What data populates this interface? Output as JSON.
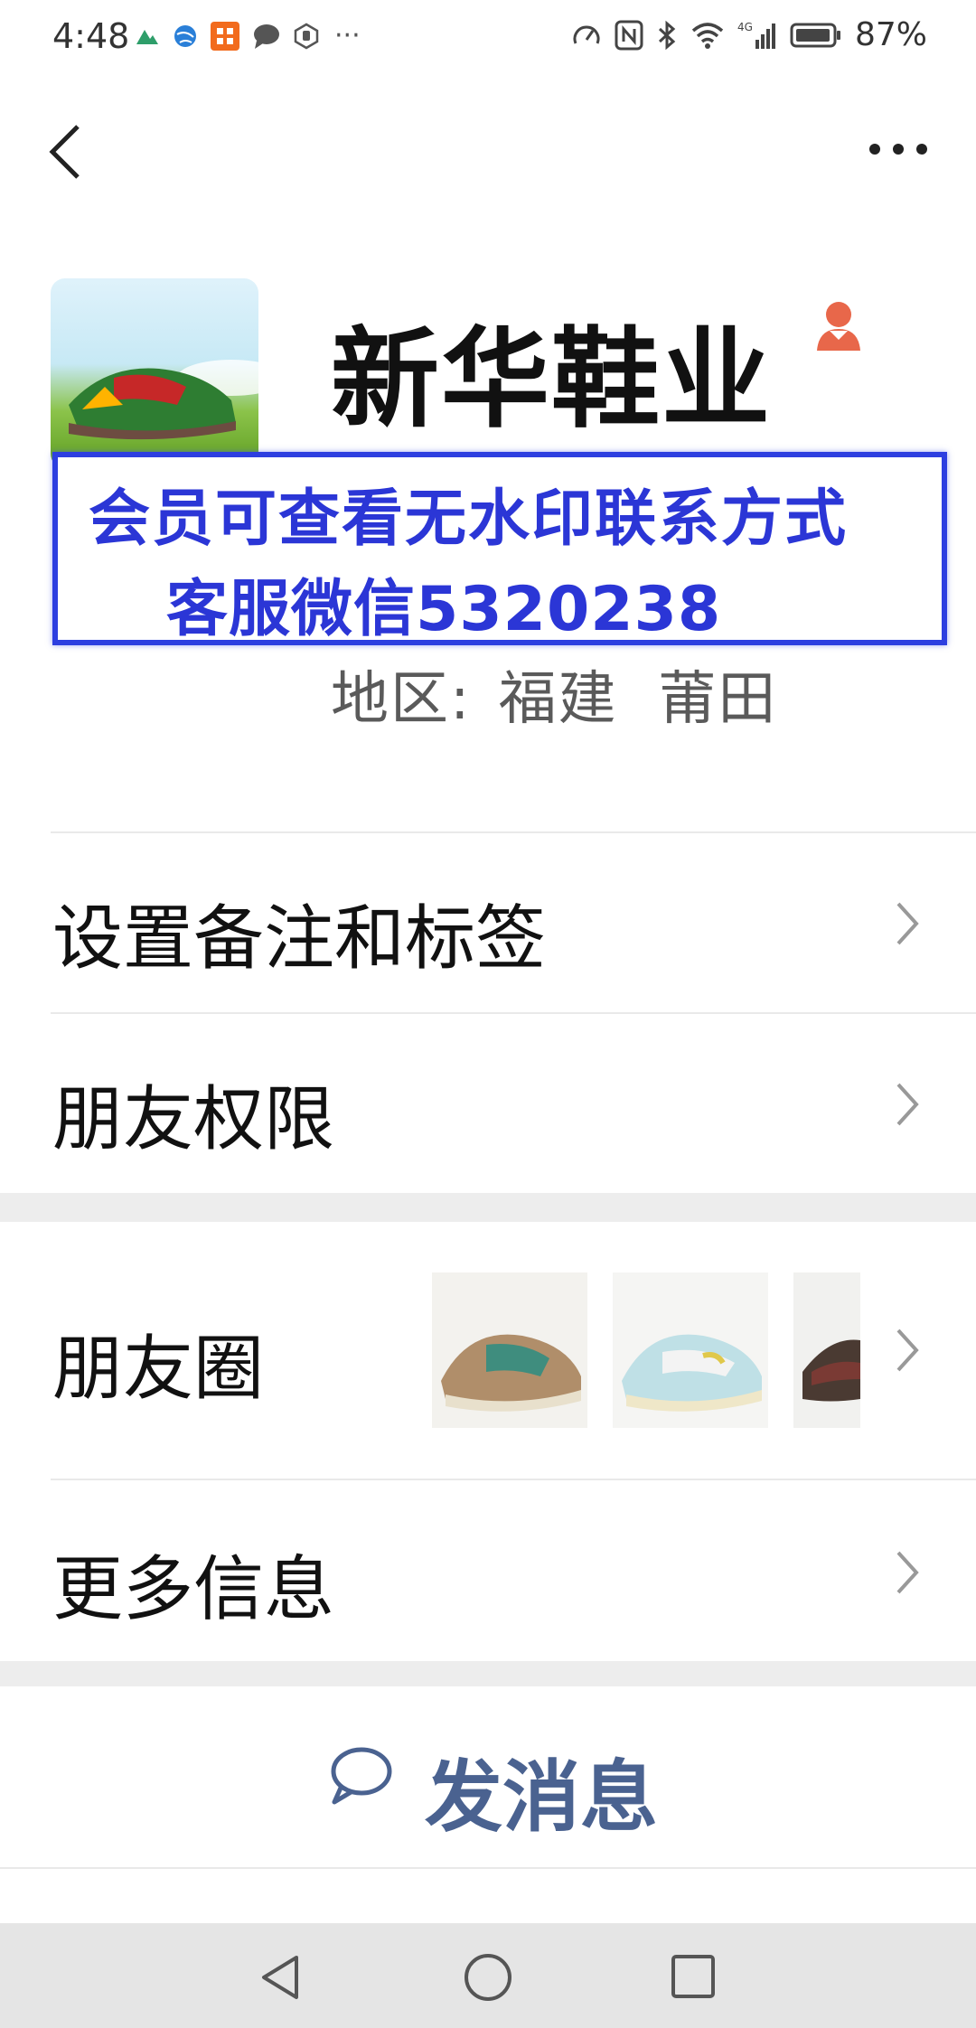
{
  "status_bar": {
    "time": "4:48",
    "battery": "87%",
    "icons_left": [
      "mountain-icon",
      "globe-icon",
      "app-icon",
      "chat-bubble-icon",
      "hand-icon",
      "more-dots-icon"
    ],
    "icons_right": [
      "speed-icon",
      "nfc-icon",
      "bluetooth-icon",
      "wifi-icon",
      "signal-4g-icon",
      "battery-icon"
    ],
    "overflow": "···",
    "network": "4G"
  },
  "header": {
    "back": "back-icon",
    "more": "more-icon"
  },
  "profile": {
    "name": "新华鞋业",
    "gender_icon": "female-icon",
    "watermark_line1": "会员可查看无水印联系方式",
    "watermark_line2": "客服微信5320238",
    "region_label": "地区:",
    "region_value": "福建  莆田"
  },
  "menu": {
    "remarks_tags": "设置备注和标签",
    "friend_permissions": "朋友权限",
    "moments": "朋友圈",
    "more_info": "更多信息"
  },
  "actions": {
    "send_message": "发消息"
  },
  "colors": {
    "accent": "#4a6290",
    "watermark": "#2b36d6",
    "section_gap": "#ededed",
    "gender": "#e8674a"
  },
  "nav_bar": {
    "back": "nav-back-icon",
    "home": "nav-home-icon",
    "recents": "nav-recents-icon"
  }
}
